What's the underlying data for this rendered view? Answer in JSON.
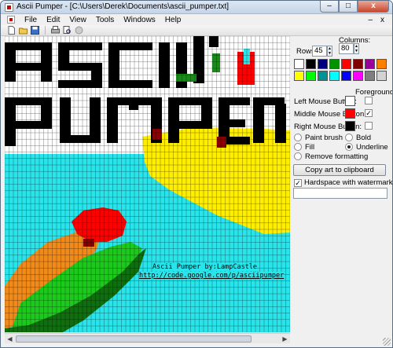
{
  "window": {
    "title": "Ascii Pumper - [C:\\Users\\Derek\\Documents\\ascii_pumper.txt]",
    "min_label": "–",
    "max_label": "□",
    "close_label": "x"
  },
  "menu": {
    "items": [
      "File",
      "Edit",
      "View",
      "Tools",
      "Windows",
      "Help"
    ],
    "right": [
      "–",
      "x"
    ]
  },
  "toolbar": {
    "icons": [
      "new-icon",
      "open-icon",
      "save-icon",
      "print-icon",
      "print-preview-icon",
      "watermark-icon"
    ]
  },
  "canvas": {
    "watermark_line1": "Ascii Pumper by:LampCastle",
    "watermark_line2": "http://code.google.com/p/asciipumper",
    "colors": {
      "grid_line": "#000000",
      "sky": "#ffffff",
      "water": "#29e4ea",
      "text_block": "#000000",
      "moon": "#ffee00",
      "body_orange": "#f08a1a",
      "body_green": "#1ec91e",
      "body_dark": "#0f6f0f",
      "head_red": "#ff0000",
      "accent_darkred": "#8b0000",
      "accent_green": "#1b8a1b",
      "accent_cyan": "#29e4ea"
    }
  },
  "panel": {
    "rows_label": "Rows:",
    "rows_value": "45",
    "columns_label": "Columns:",
    "columns_value": "80",
    "palette": [
      "#ffffff",
      "#000000",
      "#00007f",
      "#009300",
      "#ff0000",
      "#7f0000",
      "#9c009c",
      "#fc7f00",
      "#ffff00",
      "#00fc00",
      "#009393",
      "#00ffff",
      "#0000fc",
      "#ff00ff",
      "#7f7f7f",
      "#d2d2d2"
    ],
    "foreground_label": "Foreground?",
    "left_mouse_label": "Left Mouse Button:",
    "left_mouse_color": "#ffffff",
    "left_foreground_checked": false,
    "middle_mouse_label": "Middle Mouse Button:",
    "middle_mouse_color": "#ff0000",
    "middle_foreground_checked": true,
    "right_mouse_label": "Right Mouse Button:",
    "right_mouse_color": "#000000",
    "right_foreground_checked": false,
    "tools": {
      "paint_brush": "Paint brush",
      "bold": "Bold",
      "fill": "Fill",
      "underline": "Underline",
      "remove_formatting": "Remove formatting",
      "selected": "Underline"
    },
    "copy_button": "Copy art to clipboard",
    "hardspace_label": "Hardspace with watermark:",
    "hardspace_checked": true,
    "watermark_text": ""
  }
}
